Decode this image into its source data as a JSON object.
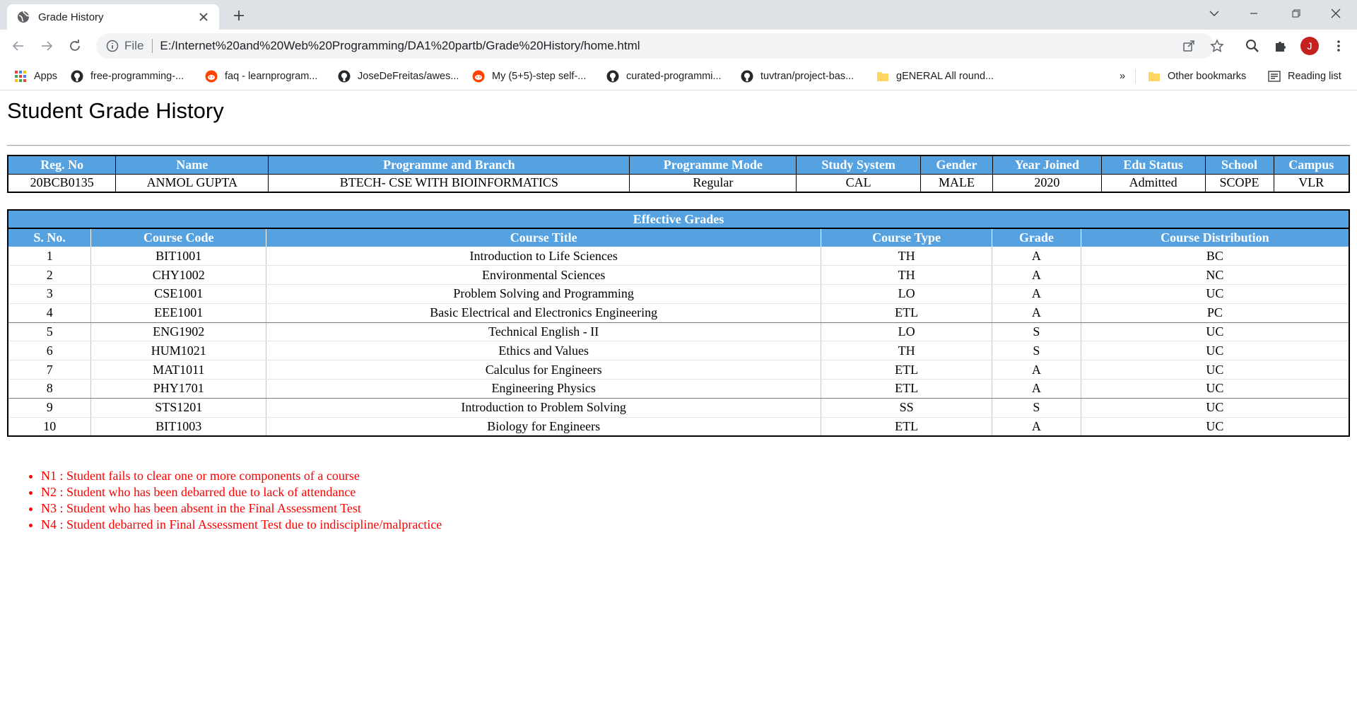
{
  "browser": {
    "tab_title": "Grade History",
    "url_scheme": "File",
    "url": "E:/Internet%20and%20Web%20Programming/DA1%20partb/Grade%20History/home.html",
    "avatar_letter": "J",
    "bookmarks": [
      {
        "label": "Apps",
        "icon": "apps-grid-icon"
      },
      {
        "label": "free-programming-...",
        "icon": "github-icon"
      },
      {
        "label": "faq - learnprogram...",
        "icon": "reddit-icon"
      },
      {
        "label": "JoseDeFreitas/awes...",
        "icon": "github-icon"
      },
      {
        "label": "My (5+5)-step self-...",
        "icon": "reddit-icon"
      },
      {
        "label": "curated-programmi...",
        "icon": "github-icon"
      },
      {
        "label": "tuvtran/project-bas...",
        "icon": "github-icon"
      },
      {
        "label": "gENERAL All round...",
        "icon": "folder-icon"
      }
    ],
    "overflow_label": "»",
    "other_bookmarks": "Other bookmarks",
    "reading_list": "Reading list"
  },
  "page": {
    "title": "Student Grade History",
    "student_table": {
      "headers": [
        "Reg. No",
        "Name",
        "Programme and Branch",
        "Programme Mode",
        "Study System",
        "Gender",
        "Year Joined",
        "Edu Status",
        "School",
        "Campus"
      ],
      "row": [
        "20BCB0135",
        "ANMOL GUPTA",
        "BTECH- CSE WITH BIOINFORMATICS",
        "Regular",
        "CAL",
        "MALE",
        "2020",
        "Admitted",
        "SCOPE",
        "VLR"
      ]
    },
    "grades_table": {
      "caption": "Effective Grades",
      "headers": [
        "S. No.",
        "Course Code",
        "Course Title",
        "Course Type",
        "Grade",
        "Course Distribution"
      ],
      "rows": [
        [
          "1",
          "BIT1001",
          "Introduction to Life Sciences",
          "TH",
          "A",
          "BC"
        ],
        [
          "2",
          "CHY1002",
          "Environmental Sciences",
          "TH",
          "A",
          "NC"
        ],
        [
          "3",
          "CSE1001",
          "Problem Solving and Programming",
          "LO",
          "A",
          "UC"
        ],
        [
          "4",
          "EEE1001",
          "Basic Electrical and Electronics Engineering",
          "ETL",
          "A",
          "PC"
        ],
        [
          "5",
          "ENG1902",
          "Technical English - II",
          "LO",
          "S",
          "UC"
        ],
        [
          "6",
          "HUM1021",
          "Ethics and Values",
          "TH",
          "S",
          "UC"
        ],
        [
          "7",
          "MAT1011",
          "Calculus for Engineers",
          "ETL",
          "A",
          "UC"
        ],
        [
          "8",
          "PHY1701",
          "Engineering Physics",
          "ETL",
          "A",
          "UC"
        ],
        [
          "9",
          "STS1201",
          "Introduction to Problem Solving",
          "SS",
          "S",
          "UC"
        ],
        [
          "10",
          "BIT1003",
          "Biology for Engineers",
          "ETL",
          "A",
          "UC"
        ]
      ]
    },
    "notes": [
      "N1 : Student fails to clear one or more components of a course",
      "N2 : Student who has been debarred due to lack of attendance",
      "N3 : Student who has been absent in the Final Assessment Test",
      "N4 : Student debarred in Final Assessment Test due to indiscipline/malpractice"
    ]
  },
  "colors": {
    "header_blue": "#56a2e1",
    "note_red": "#ff0000",
    "avatar_red": "#c5221f"
  }
}
